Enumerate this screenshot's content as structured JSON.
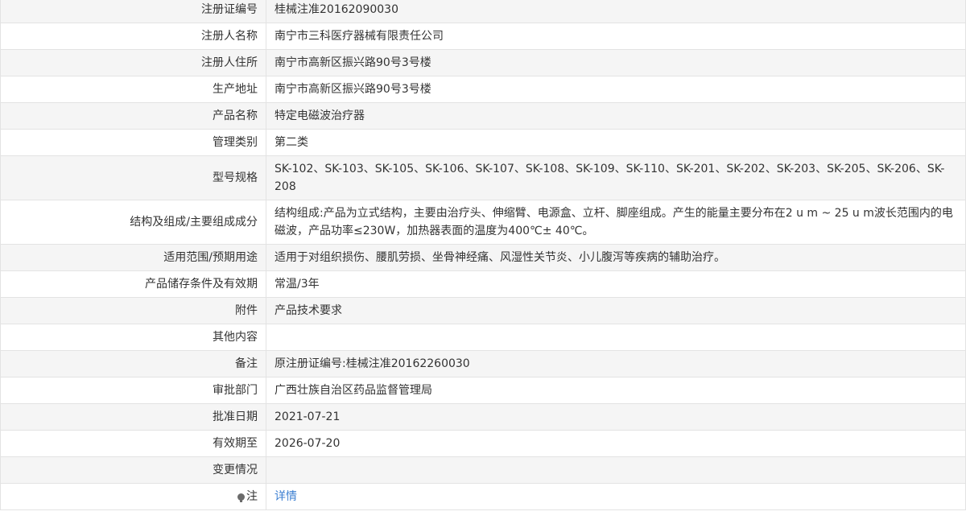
{
  "icons": {
    "note_icon": "bulb-icon"
  },
  "rows": [
    {
      "label": "注册证编号",
      "value": "桂械注准20162090030"
    },
    {
      "label": "注册人名称",
      "value": "南宁市三科医疗器械有限责任公司"
    },
    {
      "label": "注册人住所",
      "value": "南宁市高新区振兴路90号3号楼"
    },
    {
      "label": "生产地址",
      "value": "南宁市高新区振兴路90号3号楼"
    },
    {
      "label": "产品名称",
      "value": "特定电磁波治疗器"
    },
    {
      "label": "管理类别",
      "value": "第二类"
    },
    {
      "label": "型号规格",
      "value": "SK-102、SK-103、SK-105、SK-106、SK-107、SK-108、SK-109、SK-110、SK-201、SK-202、SK-203、SK-205、SK-206、SK-208"
    },
    {
      "label": "结构及组成/主要组成成分",
      "value": "结构组成:产品为立式结构，主要由治疗头、伸缩臂、电源盒、立杆、脚座组成。产生的能量主要分布在2 u m ~ 25 u m波长范围内的电磁波，产品功率≤230W，加热器表面的温度为400℃± 40℃。"
    },
    {
      "label": "适用范围/预期用途",
      "value": "适用于对组织损伤、腰肌劳损、坐骨神经痛、风湿性关节炎、小儿腹泻等疾病的辅助治疗。"
    },
    {
      "label": "产品储存条件及有效期",
      "value": "常温/3年"
    },
    {
      "label": "附件",
      "value": "产品技术要求"
    },
    {
      "label": "其他内容",
      "value": ""
    },
    {
      "label": "备注",
      "value": "原注册证编号:桂械注准20162260030"
    },
    {
      "label": "审批部门",
      "value": "广西壮族自治区药品监督管理局"
    },
    {
      "label": "批准日期",
      "value": "2021-07-21"
    },
    {
      "label": "有效期至",
      "value": "2026-07-20"
    },
    {
      "label": "变更情况",
      "value": ""
    }
  ],
  "note_row": {
    "label": "注",
    "link_text": "详情"
  }
}
